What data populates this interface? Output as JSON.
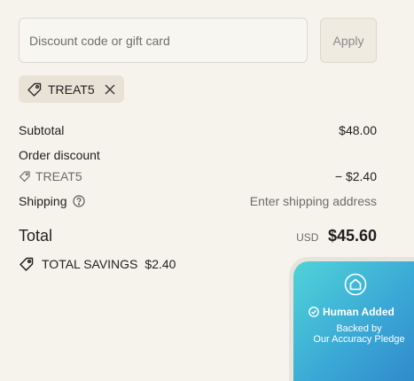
{
  "discount": {
    "placeholder": "Discount code or gift card",
    "apply_label": "Apply"
  },
  "applied_code": {
    "code": "TREAT5"
  },
  "summary": {
    "subtotal_label": "Subtotal",
    "subtotal_value": "$48.00",
    "order_discount_label": "Order discount",
    "discount_code": "TREAT5",
    "discount_value": "− $2.40",
    "shipping_label": "Shipping",
    "shipping_value": "Enter shipping address"
  },
  "total": {
    "label": "Total",
    "currency": "USD",
    "amount": "$45.60"
  },
  "savings": {
    "label": "TOTAL SAVINGS",
    "amount": "$2.40"
  },
  "badge": {
    "title": "Human Added",
    "line1": "Backed by",
    "line2": "Our Accuracy Pledge"
  },
  "colors": {
    "background": "#f6f3ec",
    "tag_background": "#e8e3d6",
    "badge_gradient_start": "#4fd3d8",
    "badge_gradient_end": "#2f86c9"
  },
  "icons": [
    "tag-icon",
    "close-icon",
    "help-icon",
    "savings-tag-icon",
    "home-icon",
    "check-circle-icon"
  ]
}
